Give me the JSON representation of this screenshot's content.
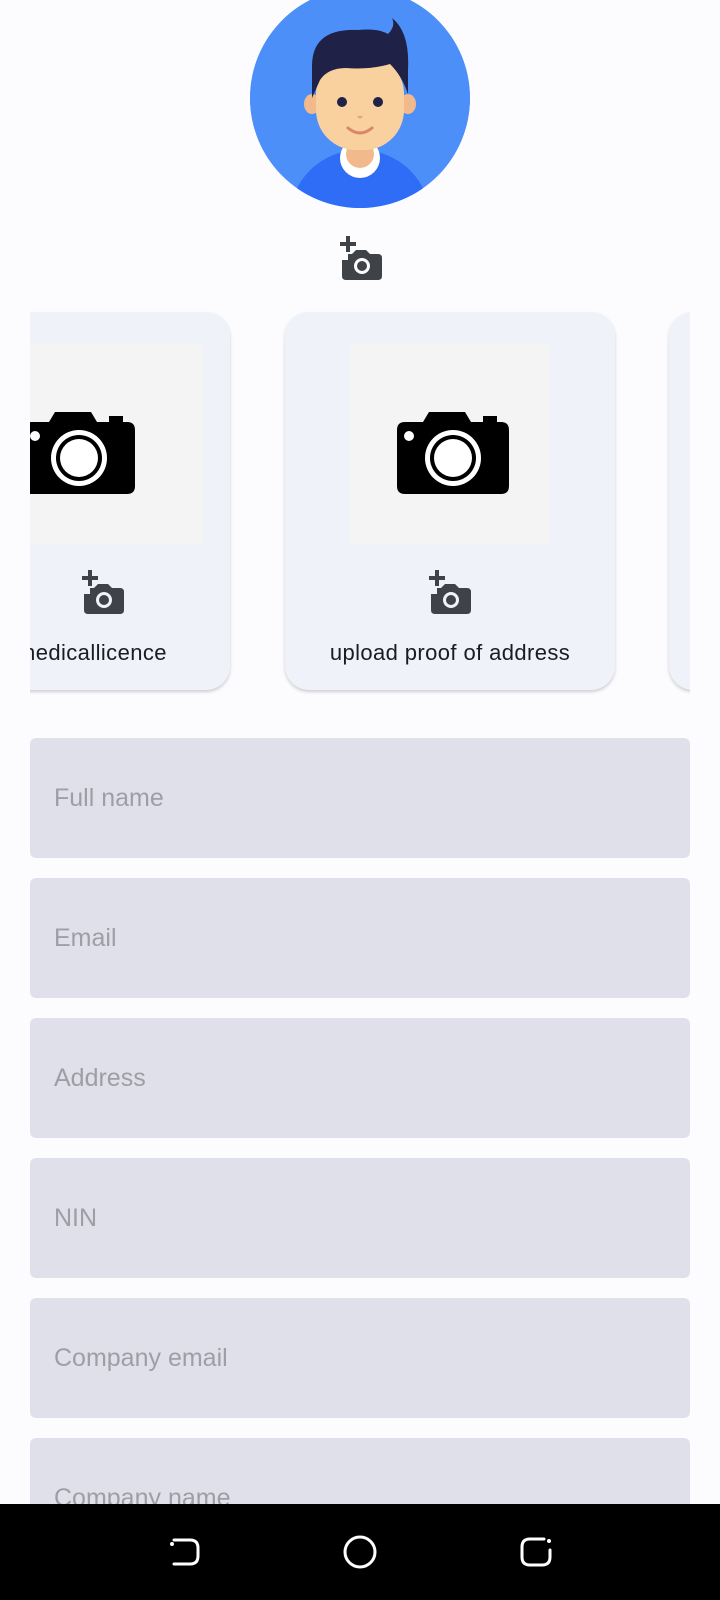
{
  "profile": {
    "avatar_icon": "user-avatar",
    "add_photo_icon": "add-a-photo-icon"
  },
  "documents": [
    {
      "label": "medicallicence",
      "thumb_icon": "camera-icon",
      "add_icon": "add-a-photo-icon"
    },
    {
      "label": "upload proof of address",
      "thumb_icon": "camera-icon",
      "add_icon": "add-a-photo-icon"
    }
  ],
  "form": {
    "fields": [
      {
        "placeholder": "Full name",
        "value": ""
      },
      {
        "placeholder": "Email",
        "value": ""
      },
      {
        "placeholder": "Address",
        "value": ""
      },
      {
        "placeholder": "NIN",
        "value": ""
      },
      {
        "placeholder": "Company email",
        "value": ""
      },
      {
        "placeholder": "Company name",
        "value": ""
      }
    ]
  },
  "nav_bar": {
    "back_icon": "back-icon",
    "home_icon": "home-icon",
    "recents_icon": "recents-icon"
  },
  "colors": {
    "background": "#fcfbfe",
    "avatar_bg": "#4d8ff9",
    "card_bg": "#eff2f8",
    "field_bg": "#dfe0ea",
    "placeholder": "#9e9ea6",
    "nav_bar": "#000000"
  }
}
